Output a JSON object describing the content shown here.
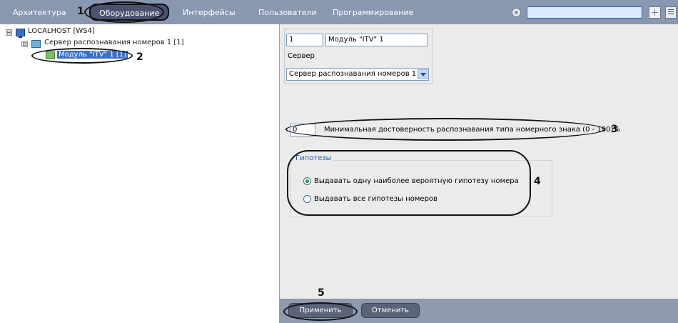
{
  "toolbar": {
    "tabs": [
      {
        "label": "Архитектура"
      },
      {
        "label": "Оборудование"
      },
      {
        "label": "Интерфейсы"
      },
      {
        "label": "Пользователи"
      },
      {
        "label": "Программирование"
      }
    ],
    "search_value": "",
    "icons": [
      "record-icon",
      "grid-view-icon",
      "menu-icon"
    ]
  },
  "tree": {
    "root": "LOCALHOST [WS4]",
    "server": "Сервер распознавания номеров 1 [1]",
    "module": "Модуль \"ITV\" 1 [1]",
    "expander_symbol": "⊟"
  },
  "settings": {
    "id_value": "1",
    "name_value": "Модуль \"ITV\" 1",
    "server_label": "Сервер",
    "server_value": "Сервер распознавания номеров 1",
    "min_confidence_value": "0",
    "min_confidence_label": "Минимальная достоверность распознавания типа номерного знака (0 - 100)%",
    "hypotheses_title": "Гипотезы",
    "hypothesis_options": [
      {
        "label": "Выдавать одну наиболее вероятную гипотезу номера",
        "selected": true
      },
      {
        "label": "Выдавать все гипотезы номеров",
        "selected": false
      }
    ]
  },
  "buttons": {
    "apply": "Применить",
    "cancel": "Отменить"
  },
  "annotations": [
    "1",
    "2",
    "3",
    "4",
    "5"
  ],
  "colors": {
    "toolbar_bg": "#8a97b1",
    "active_tab_bg": "#4a5470",
    "panel_bg": "#ebebeb",
    "selection": "#3c6ec2",
    "bottom_bar": "#8f9aae"
  }
}
